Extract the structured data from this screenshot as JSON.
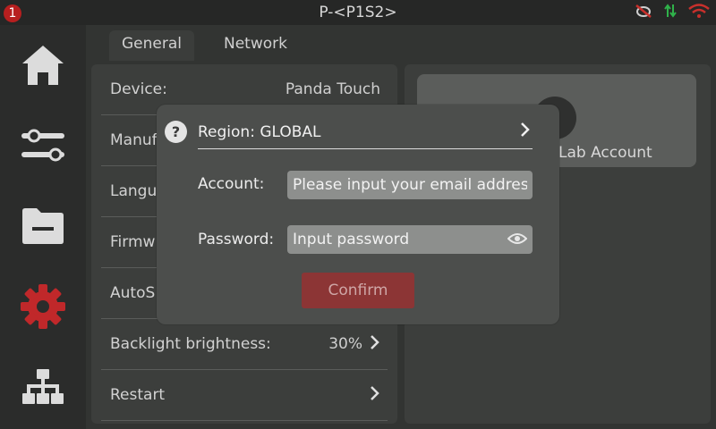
{
  "status_bar": {
    "notification_count": "1",
    "printer_name": "P-<P1S2>",
    "icons": [
      "camera-off-icon",
      "transfer-arrows-icon",
      "wifi-icon"
    ]
  },
  "sidebar": {
    "items": [
      {
        "icon": "home-icon"
      },
      {
        "icon": "sliders-icon"
      },
      {
        "icon": "folder-icon"
      },
      {
        "icon": "gear-icon",
        "active": true
      },
      {
        "icon": "network-icon"
      }
    ],
    "active_color": "#c0282a"
  },
  "tabs": [
    {
      "label": "General",
      "active": true
    },
    {
      "label": "Network",
      "active": false
    }
  ],
  "settings": {
    "device_label": "Device:",
    "device_value": "Panda Touch",
    "manufacturer_label": "Manuf",
    "language_label": "Langu",
    "firmware_label": "Firmw",
    "autosleep_label": "AutoS",
    "backlight_label": "Backlight brightness:",
    "backlight_value": "30%",
    "restart_label": "Restart"
  },
  "account_card": {
    "label": "Lab Account"
  },
  "login_dialog": {
    "help_symbol": "?",
    "region_label": "Region: GLOBAL",
    "account_label": "Account:",
    "account_placeholder": "Please input your email address",
    "password_label": "Password:",
    "password_placeholder": "Input password",
    "confirm_label": "Confirm"
  }
}
